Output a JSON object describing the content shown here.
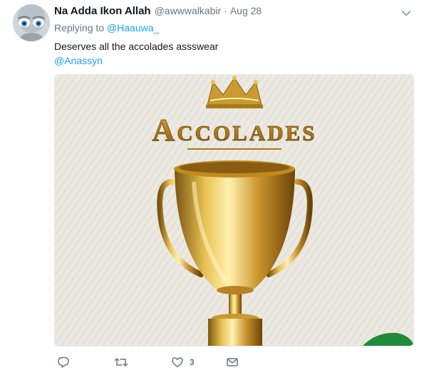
{
  "tweet": {
    "author_name": "Na Adda Ikon Allah",
    "author_handle": "@awwwalkabir",
    "separator": "·",
    "timestamp": "Aug 28",
    "replying_prefix": "Replying to",
    "replying_to": "@Haauwa_",
    "text": "Deserves all the accolades assswear",
    "mention_link": "@Anassyn",
    "image_text": "Accolades",
    "like_count": "3"
  },
  "icons": {
    "menu": "chevron-down-icon",
    "reply": "reply-icon",
    "retweet": "retweet-icon",
    "like": "heart-icon",
    "message": "envelope-icon"
  },
  "colors": {
    "link": "#1da1f2",
    "secondary_text": "#657786",
    "primary_text": "#14171a",
    "gold": "#c99a2e"
  }
}
